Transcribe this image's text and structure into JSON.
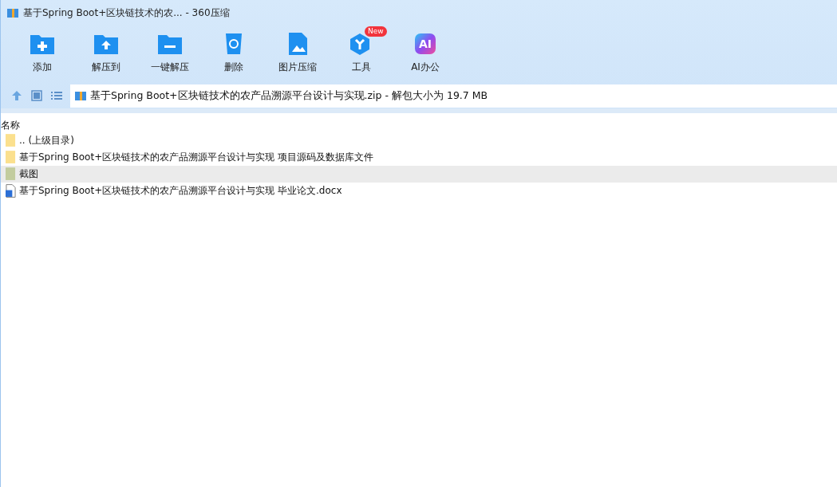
{
  "window": {
    "title": "基于Spring Boot+区块链技术的农... - 360压缩"
  },
  "toolbar": [
    {
      "kind": "add",
      "label": "添加"
    },
    {
      "kind": "extract",
      "label": "解压到"
    },
    {
      "kind": "oneclick",
      "label": "一键解压"
    },
    {
      "kind": "delete",
      "label": "删除"
    },
    {
      "kind": "image",
      "label": "图片压缩"
    },
    {
      "kind": "tools",
      "label": "工具",
      "badge": "New"
    },
    {
      "kind": "ai",
      "label": "AI办公",
      "icon_text": "AI"
    }
  ],
  "address": {
    "path": "基于Spring Boot+区块链技术的农产品溯源平台设计与实现.zip - 解包大小为 19.7 MB"
  },
  "list": {
    "columns": [
      "名称"
    ],
    "rows": [
      {
        "kind": "folder",
        "name": ".. (上级目录)",
        "selected": false
      },
      {
        "kind": "folder",
        "name": "基于Spring Boot+区块链技术的农产品溯源平台设计与实现 项目源码及数据库文件",
        "selected": false
      },
      {
        "kind": "folder",
        "name": "截图",
        "selected": true
      },
      {
        "kind": "docx",
        "name": "基于Spring Boot+区块链技术的农产品溯源平台设计与实现 毕业论文.docx",
        "selected": false
      }
    ]
  }
}
